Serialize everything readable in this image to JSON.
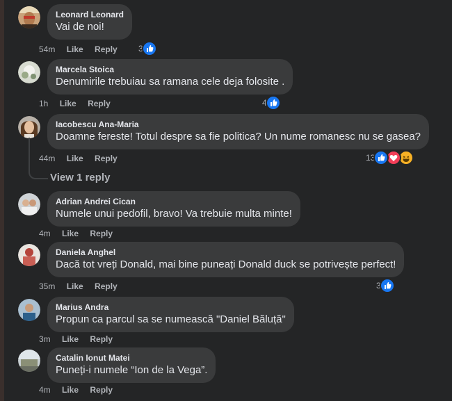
{
  "colors": {
    "background": "#242526",
    "bubble": "#3a3b3c",
    "text": "#e4e6eb",
    "secondary": "#b0b3b8",
    "like_blue": "#1877f2",
    "love_red": "#f33e58",
    "haha_yellow": "#f7b125"
  },
  "comments": [
    {
      "author": "Leonard Leonard",
      "text": "Vai de noi!",
      "time": "54m",
      "like_label": "Like",
      "reply_label": "Reply",
      "reaction_count": "3",
      "reactions": [
        "like-icon"
      ]
    },
    {
      "author": "Marcela Stoica",
      "text": "Denumirile trebuiau sa ramana cele deja folosite .",
      "time": "1h",
      "like_label": "Like",
      "reply_label": "Reply",
      "reaction_count": "4",
      "reactions": [
        "like-icon"
      ]
    },
    {
      "author": "Iacobescu Ana-Maria",
      "text": "Doamne fereste! Totul despre sa fie politica? Un nume romanesc nu se gasea?",
      "time": "44m",
      "like_label": "Like",
      "reply_label": "Reply",
      "reaction_count": "13",
      "reactions": [
        "like-icon",
        "love-icon",
        "haha-icon"
      ],
      "view_replies": "View 1 reply"
    },
    {
      "author": "Adrian Andrei Cican",
      "text": "Numele unui pedofil, bravo! Va trebuie multa minte!",
      "time": "4m",
      "like_label": "Like",
      "reply_label": "Reply"
    },
    {
      "author": "Daniela Anghel",
      "text": "Dacă tot vreți Donald, mai bine puneați Donald duck se potrivește perfect!",
      "time": "35m",
      "like_label": "Like",
      "reply_label": "Reply",
      "reaction_count": "3",
      "reactions": [
        "like-icon"
      ]
    },
    {
      "author": "Marius Andra",
      "text": "Propun ca parcul sa se numească \"Daniel Băluță\"",
      "time": "3m",
      "like_label": "Like",
      "reply_label": "Reply"
    },
    {
      "author": "Catalin Ionut Matei",
      "text": "Puneți-i numele “Ion de la Vega”.",
      "time": "4m",
      "like_label": "Like",
      "reply_label": "Reply"
    }
  ]
}
